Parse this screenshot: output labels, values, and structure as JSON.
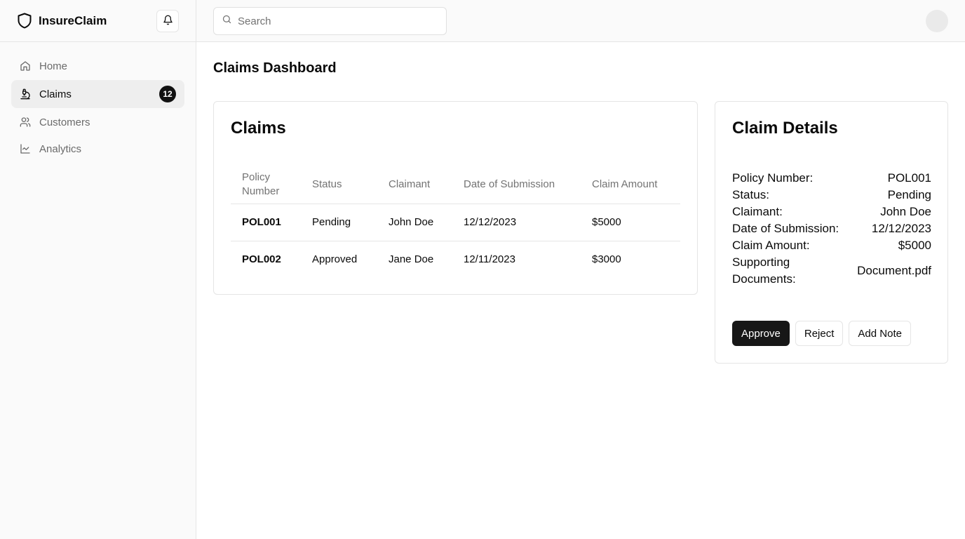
{
  "app": {
    "name": "InsureClaim"
  },
  "sidebar": {
    "items": [
      {
        "label": "Home",
        "icon": "home-icon"
      },
      {
        "label": "Claims",
        "icon": "claims-icon",
        "badge": "12",
        "active": true
      },
      {
        "label": "Customers",
        "icon": "users-icon"
      },
      {
        "label": "Analytics",
        "icon": "chart-line-icon"
      }
    ]
  },
  "search": {
    "placeholder": "Search",
    "value": ""
  },
  "page": {
    "title": "Claims Dashboard"
  },
  "claims": {
    "title": "Claims",
    "columns": [
      "Policy Number",
      "Status",
      "Claimant",
      "Date of Submission",
      "Claim Amount"
    ],
    "rows": [
      {
        "policy": "POL001",
        "status": "Pending",
        "claimant": "John Doe",
        "date": "12/12/2023",
        "amount": "$5000"
      },
      {
        "policy": "POL002",
        "status": "Approved",
        "claimant": "Jane Doe",
        "date": "12/11/2023",
        "amount": "$3000"
      }
    ]
  },
  "details": {
    "title": "Claim Details",
    "fields": [
      {
        "label": "Policy Number:",
        "value": "POL001"
      },
      {
        "label": "Status:",
        "value": "Pending"
      },
      {
        "label": "Claimant:",
        "value": "John Doe"
      },
      {
        "label": "Date of Submission:",
        "value": "12/12/2023"
      },
      {
        "label": "Claim Amount:",
        "value": "$5000"
      },
      {
        "label": "Supporting Documents:",
        "value": "Document.pdf"
      }
    ],
    "actions": {
      "approve": "Approve",
      "reject": "Reject",
      "add_note": "Add Note"
    }
  },
  "colors": {
    "primary": "#171717",
    "sidebar_bg": "#fafafa",
    "border": "#e5e5e5",
    "muted": "#737373"
  }
}
